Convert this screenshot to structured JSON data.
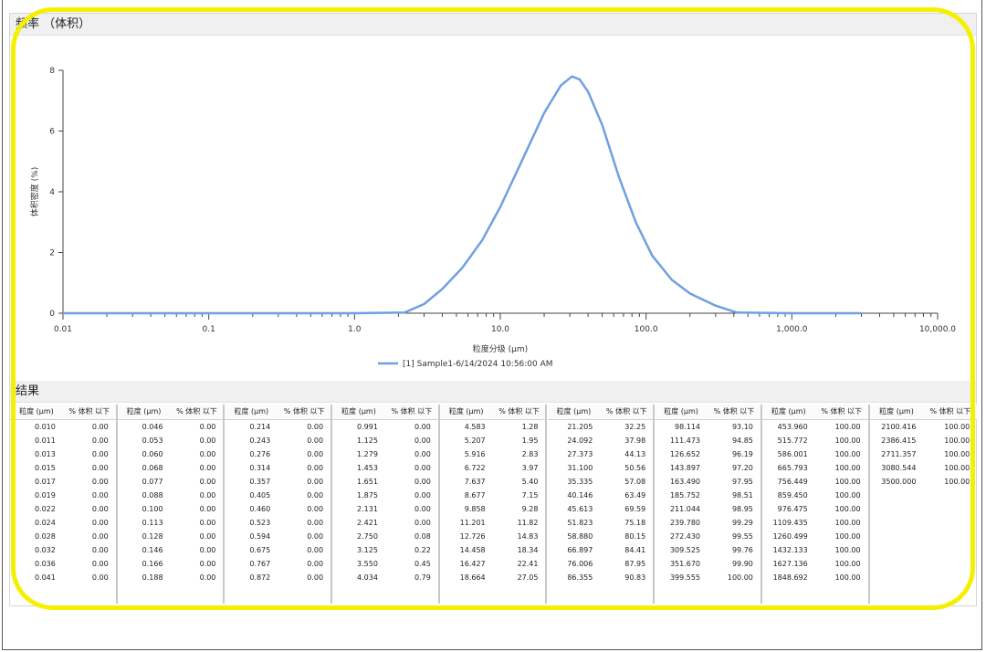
{
  "freq_header": "频率 （体积）",
  "results_header": "结果",
  "colors": {
    "series": "#6fa0e0",
    "highlight": "#f5f000"
  },
  "chart_data": {
    "type": "line",
    "xscale": "log",
    "xlabel": "粒度分级 (μm)",
    "ylabel": "体积密度 (%)",
    "xlim": [
      0.01,
      10000
    ],
    "ylim": [
      0,
      8
    ],
    "xticks": [
      "0.01",
      "0.1",
      "1.0",
      "10.0",
      "100.0",
      "1,000.0",
      "10,000.0"
    ],
    "yticks": [
      "0",
      "2",
      "4",
      "6",
      "8"
    ],
    "legend_position": "bottom",
    "series": [
      {
        "name": "[1] Sample1-6/14/2024 10:56:00 AM",
        "x": [
          0.01,
          1.0,
          2.2,
          3.0,
          4.0,
          5.5,
          7.5,
          10.0,
          14.0,
          20.0,
          26.0,
          31.0,
          35.0,
          40.0,
          50.0,
          65.0,
          85.0,
          110.0,
          150.0,
          200.0,
          300.0,
          420.0,
          1000.0,
          3000.0
        ],
        "y": [
          0,
          0,
          0.02,
          0.3,
          0.8,
          1.5,
          2.4,
          3.5,
          5.0,
          6.6,
          7.5,
          7.8,
          7.7,
          7.3,
          6.2,
          4.5,
          3.0,
          1.9,
          1.1,
          0.65,
          0.25,
          0.02,
          0,
          0
        ]
      }
    ]
  },
  "table": {
    "col_header": {
      "size": "粒度 (μm)",
      "pct": "% 体积 以下"
    },
    "columns": [
      {
        "rows": [
          [
            "0.010",
            "0.00"
          ],
          [
            "0.011",
            "0.00"
          ],
          [
            "0.013",
            "0.00"
          ],
          [
            "0.015",
            "0.00"
          ],
          [
            "0.017",
            "0.00"
          ],
          [
            "0.019",
            "0.00"
          ],
          [
            "0.022",
            "0.00"
          ],
          [
            "0.024",
            "0.00"
          ],
          [
            "0.028",
            "0.00"
          ],
          [
            "0.032",
            "0.00"
          ],
          [
            "0.036",
            "0.00"
          ],
          [
            "0.041",
            "0.00"
          ]
        ]
      },
      {
        "rows": [
          [
            "0.046",
            "0.00"
          ],
          [
            "0.053",
            "0.00"
          ],
          [
            "0.060",
            "0.00"
          ],
          [
            "0.068",
            "0.00"
          ],
          [
            "0.077",
            "0.00"
          ],
          [
            "0.088",
            "0.00"
          ],
          [
            "0.100",
            "0.00"
          ],
          [
            "0.113",
            "0.00"
          ],
          [
            "0.128",
            "0.00"
          ],
          [
            "0.146",
            "0.00"
          ],
          [
            "0.166",
            "0.00"
          ],
          [
            "0.188",
            "0.00"
          ]
        ]
      },
      {
        "rows": [
          [
            "0.214",
            "0.00"
          ],
          [
            "0.243",
            "0.00"
          ],
          [
            "0.276",
            "0.00"
          ],
          [
            "0.314",
            "0.00"
          ],
          [
            "0.357",
            "0.00"
          ],
          [
            "0.405",
            "0.00"
          ],
          [
            "0.460",
            "0.00"
          ],
          [
            "0.523",
            "0.00"
          ],
          [
            "0.594",
            "0.00"
          ],
          [
            "0.675",
            "0.00"
          ],
          [
            "0.767",
            "0.00"
          ],
          [
            "0.872",
            "0.00"
          ]
        ]
      },
      {
        "rows": [
          [
            "0.991",
            "0.00"
          ],
          [
            "1.125",
            "0.00"
          ],
          [
            "1.279",
            "0.00"
          ],
          [
            "1.453",
            "0.00"
          ],
          [
            "1.651",
            "0.00"
          ],
          [
            "1.875",
            "0.00"
          ],
          [
            "2.131",
            "0.00"
          ],
          [
            "2.421",
            "0.00"
          ],
          [
            "2.750",
            "0.08"
          ],
          [
            "3.125",
            "0.22"
          ],
          [
            "3.550",
            "0.45"
          ],
          [
            "4.034",
            "0.79"
          ]
        ]
      },
      {
        "rows": [
          [
            "4.583",
            "1.28"
          ],
          [
            "5.207",
            "1.95"
          ],
          [
            "5.916",
            "2.83"
          ],
          [
            "6.722",
            "3.97"
          ],
          [
            "7.637",
            "5.40"
          ],
          [
            "8.677",
            "7.15"
          ],
          [
            "9.858",
            "9.28"
          ],
          [
            "11.201",
            "11.82"
          ],
          [
            "12.726",
            "14.83"
          ],
          [
            "14.458",
            "18.34"
          ],
          [
            "16.427",
            "22.41"
          ],
          [
            "18.664",
            "27.05"
          ]
        ]
      },
      {
        "rows": [
          [
            "21.205",
            "32.25"
          ],
          [
            "24.092",
            "37.98"
          ],
          [
            "27.373",
            "44.13"
          ],
          [
            "31.100",
            "50.56"
          ],
          [
            "35.335",
            "57.08"
          ],
          [
            "40.146",
            "63.49"
          ],
          [
            "45.613",
            "69.59"
          ],
          [
            "51.823",
            "75.18"
          ],
          [
            "58.880",
            "80.15"
          ],
          [
            "66.897",
            "84.41"
          ],
          [
            "76.006",
            "87.95"
          ],
          [
            "86.355",
            "90.83"
          ]
        ]
      },
      {
        "rows": [
          [
            "98.114",
            "93.10"
          ],
          [
            "111.473",
            "94.85"
          ],
          [
            "126.652",
            "96.19"
          ],
          [
            "143.897",
            "97.20"
          ],
          [
            "163.490",
            "97.95"
          ],
          [
            "185.752",
            "98.51"
          ],
          [
            "211.044",
            "98.95"
          ],
          [
            "239.780",
            "99.29"
          ],
          [
            "272.430",
            "99.55"
          ],
          [
            "309.525",
            "99.76"
          ],
          [
            "351.670",
            "99.90"
          ],
          [
            "399.555",
            "100.00"
          ]
        ]
      },
      {
        "rows": [
          [
            "453.960",
            "100.00"
          ],
          [
            "515.772",
            "100.00"
          ],
          [
            "586.001",
            "100.00"
          ],
          [
            "665.793",
            "100.00"
          ],
          [
            "756.449",
            "100.00"
          ],
          [
            "859.450",
            "100.00"
          ],
          [
            "976.475",
            "100.00"
          ],
          [
            "1109.435",
            "100.00"
          ],
          [
            "1260.499",
            "100.00"
          ],
          [
            "1432.133",
            "100.00"
          ],
          [
            "1627.136",
            "100.00"
          ],
          [
            "1848.692",
            "100.00"
          ]
        ]
      },
      {
        "rows": [
          [
            "2100.416",
            "100.00"
          ],
          [
            "2386.415",
            "100.00"
          ],
          [
            "2711.357",
            "100.00"
          ],
          [
            "3080.544",
            "100.00"
          ],
          [
            "3500.000",
            "100.00"
          ]
        ]
      }
    ]
  }
}
